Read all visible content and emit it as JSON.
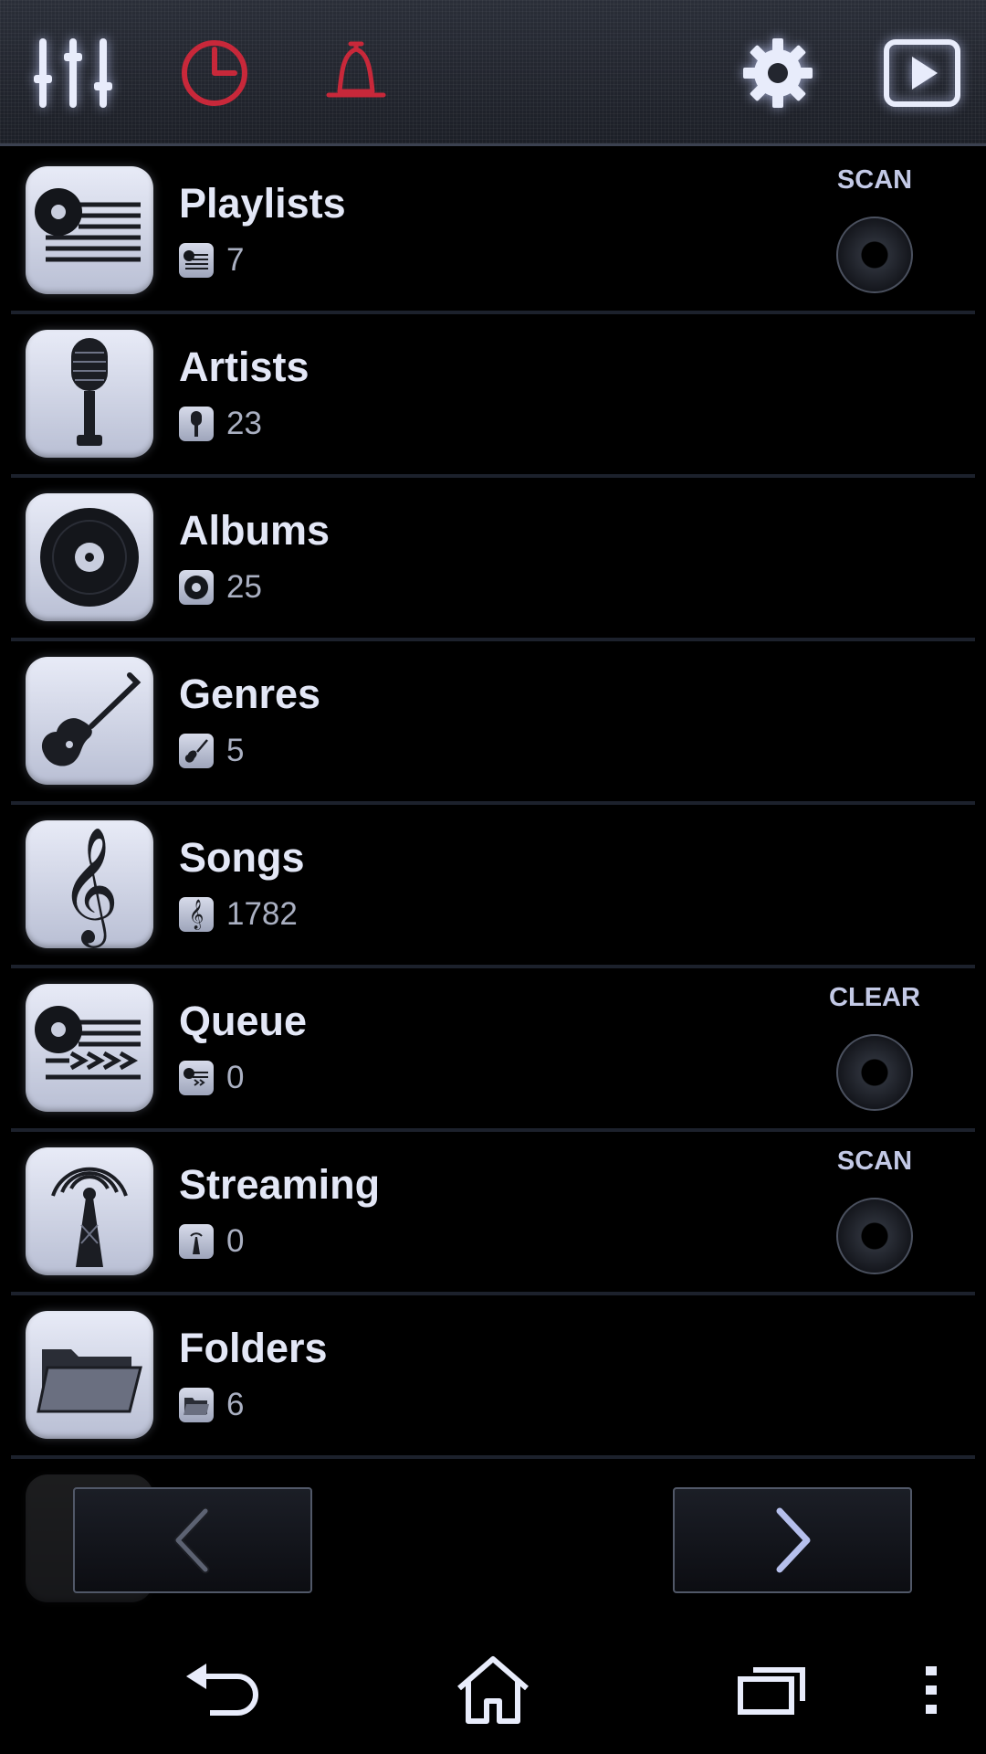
{
  "toolbar": {
    "icons": [
      "equalizer-icon",
      "timer-icon",
      "alarm-bell-icon",
      "settings-gear-icon",
      "now-playing-icon"
    ],
    "accent_color": "#c8283a"
  },
  "library": {
    "items": [
      {
        "label": "Playlists",
        "count": "7",
        "icon": "playlist-icon",
        "action": "SCAN"
      },
      {
        "label": "Artists",
        "count": "23",
        "icon": "microphone-icon"
      },
      {
        "label": "Albums",
        "count": "25",
        "icon": "disc-icon"
      },
      {
        "label": "Genres",
        "count": "5",
        "icon": "guitar-icon"
      },
      {
        "label": "Songs",
        "count": "1782",
        "icon": "treble-clef-icon"
      },
      {
        "label": "Queue",
        "count": "0",
        "icon": "queue-icon",
        "action": "CLEAR"
      },
      {
        "label": "Streaming",
        "count": "0",
        "icon": "antenna-icon",
        "action": "SCAN"
      },
      {
        "label": "Folders",
        "count": "6",
        "icon": "folder-icon"
      }
    ]
  },
  "pager": {
    "prev_icon": "chevron-left-icon",
    "next_icon": "chevron-right-icon"
  },
  "system_nav": {
    "icons": [
      "back-icon",
      "home-icon",
      "recent-apps-icon",
      "overflow-menu-icon"
    ]
  }
}
